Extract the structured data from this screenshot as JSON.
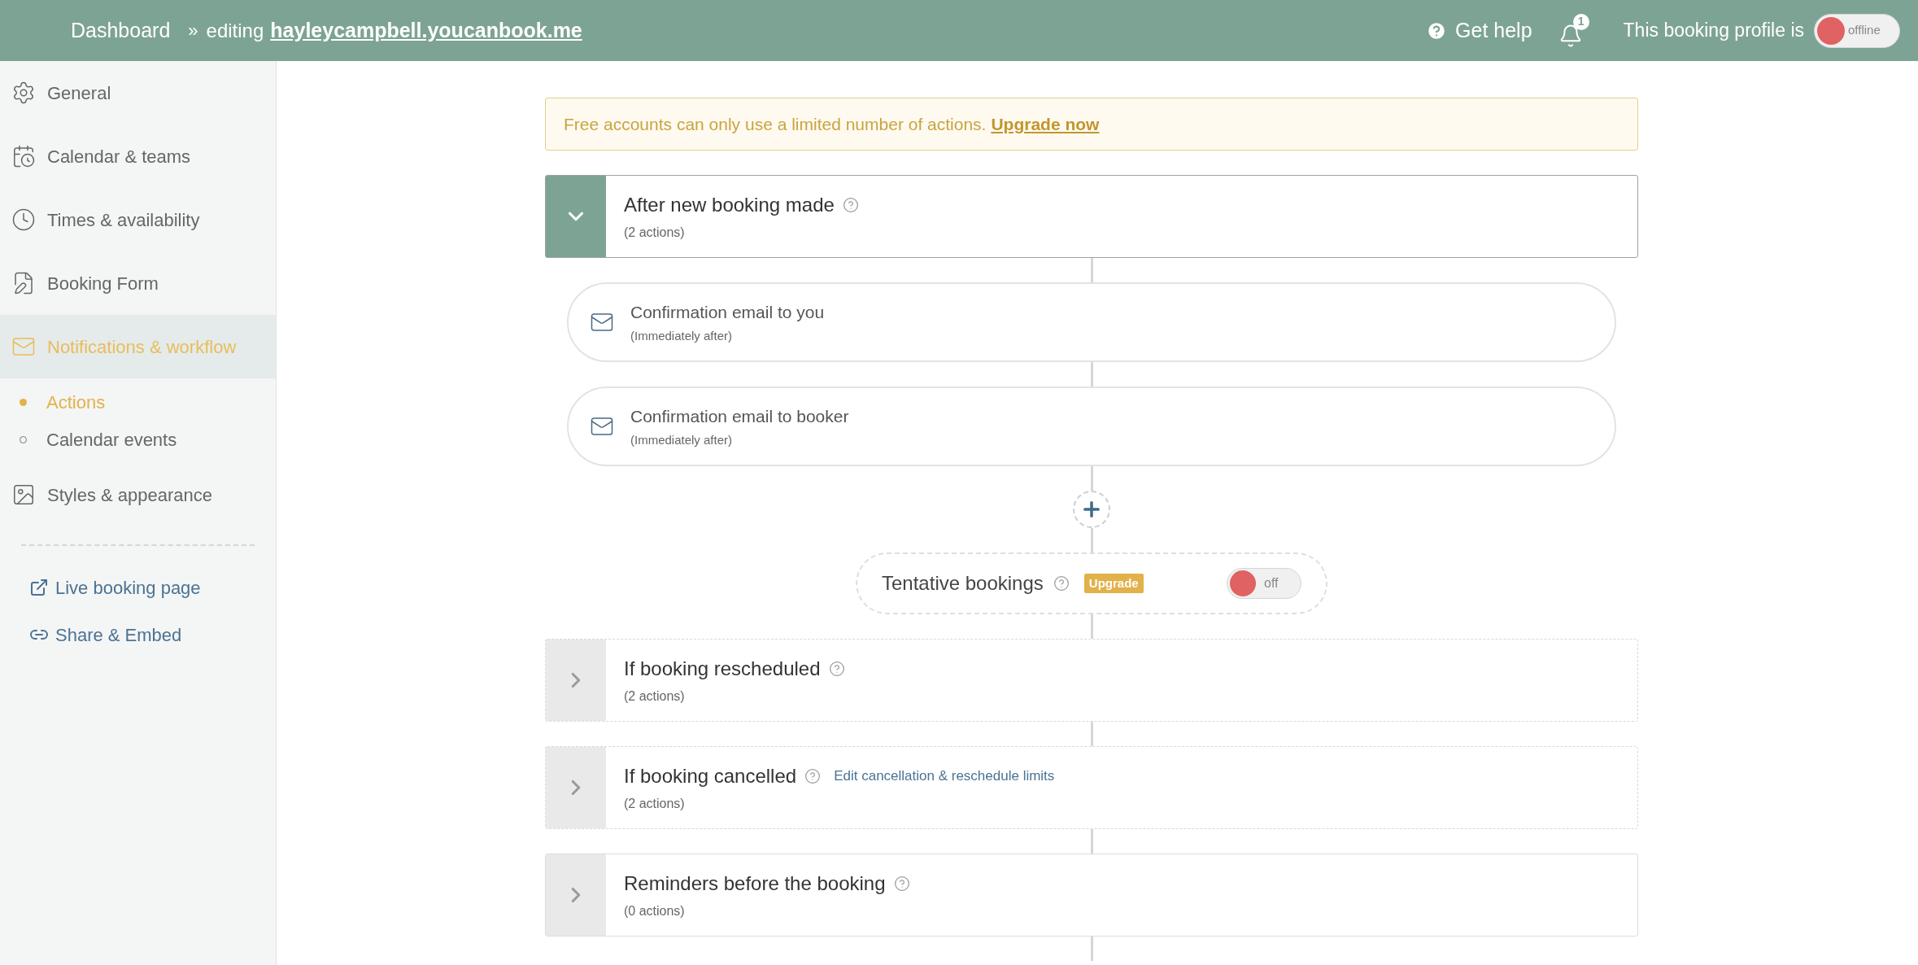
{
  "header": {
    "home": "Dashboard",
    "separator": "»",
    "editing_label": "editing",
    "profile_link": "hayleycampbell.youcanbook.me",
    "help": "Get help",
    "notification_count": "1",
    "status_label": "This booking profile is",
    "status_toggle": {
      "on": false,
      "label": "offline"
    }
  },
  "sidebar": {
    "items": [
      {
        "label": "General",
        "selected": false
      },
      {
        "label": "Calendar & teams",
        "selected": false
      },
      {
        "label": "Times & availability",
        "selected": false
      },
      {
        "label": "Booking Form",
        "selected": false
      },
      {
        "label": "Notifications & workflow",
        "selected": true,
        "children": [
          {
            "label": "Actions",
            "selected": true
          },
          {
            "label": "Calendar events",
            "selected": false
          }
        ]
      },
      {
        "label": "Styles & appearance",
        "selected": false
      }
    ],
    "links": [
      {
        "label": "Live booking page"
      },
      {
        "label": "Share & Embed"
      }
    ]
  },
  "banner": {
    "text": "Free accounts can only use a limited number of actions.",
    "link": "Upgrade now"
  },
  "workflow": [
    {
      "kind": "trigger",
      "title": "After new booking made",
      "count": "(2 actions)",
      "expanded": true,
      "dashed": false,
      "actions": [
        {
          "title": "Confirmation email to you",
          "timing": "(Immediately after)"
        },
        {
          "title": "Confirmation email to booker",
          "timing": "(Immediately after)"
        }
      ]
    },
    {
      "kind": "add"
    },
    {
      "kind": "setting",
      "title": "Tentative bookings",
      "badge": "Upgrade",
      "toggle": {
        "on": false,
        "label": "off"
      }
    },
    {
      "kind": "trigger",
      "title": "If booking rescheduled",
      "count": "(2 actions)",
      "expanded": false,
      "dashed": true
    },
    {
      "kind": "trigger",
      "title": "If booking cancelled",
      "count": "(2 actions)",
      "expanded": false,
      "dashed": true,
      "link": "Edit cancellation & reschedule limits"
    },
    {
      "kind": "trigger",
      "title": "Reminders before the booking",
      "count": "(0 actions)",
      "expanded": false,
      "dashed": false
    }
  ]
}
